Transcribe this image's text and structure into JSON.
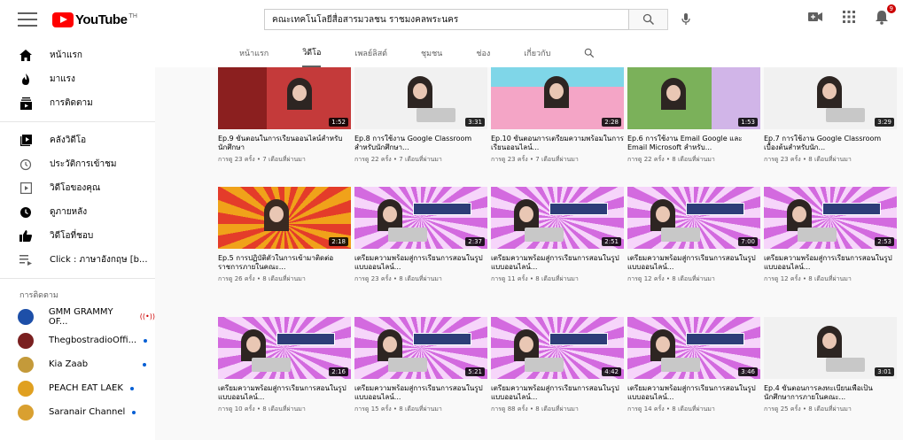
{
  "header": {
    "logo_text": "YouTube",
    "logo_region": "TH",
    "search_value": "คณะเทคโนโลยีสื่อสารมวลชน ราชมงคลพระนคร",
    "notif_count": "9"
  },
  "sidebar": {
    "main": [
      {
        "label": "หน้าแรก",
        "icon": "home-icon"
      },
      {
        "label": "มาแรง",
        "icon": "flame-icon"
      },
      {
        "label": "การติดตาม",
        "icon": "subscriptions-icon"
      }
    ],
    "library": [
      {
        "label": "คลังวิดีโอ",
        "icon": "library-icon"
      },
      {
        "label": "ประวัติการเข้าชม",
        "icon": "history-icon"
      },
      {
        "label": "วิดีโอของคุณ",
        "icon": "your-videos-icon"
      },
      {
        "label": "ดูภายหลัง",
        "icon": "watch-later-icon"
      },
      {
        "label": "วิดีโอที่ชอบ",
        "icon": "like-icon"
      },
      {
        "label": "Click : ภาษาอังกฤษ [b...",
        "icon": "playlist-icon"
      }
    ],
    "subs_heading": "การติดตาม",
    "subs": [
      {
        "label": "GMM GRAMMY OF...",
        "color": "#1d4fa8",
        "live": true
      },
      {
        "label": "ThegbostradioOffi...",
        "color": "#7a2020",
        "live": false
      },
      {
        "label": "Kia Zaab",
        "color": "#c49a3a",
        "live": false
      },
      {
        "label": "PEACH EAT LAEK",
        "color": "#e0a020",
        "live": false
      },
      {
        "label": "Saranair Channel",
        "color": "#d9a030",
        "live": false
      }
    ]
  },
  "tabs": [
    "หน้าแรก",
    "วิดีโอ",
    "เพลย์ลิสต์",
    "ชุมชน",
    "ช่อง",
    "เกี่ยวกับ"
  ],
  "active_tab": 1,
  "videos": [
    [
      {
        "title": "Ep.9 ขั้นตอนในการเรียนออนไลน์สำหรับนักศึกษา",
        "meta": "การดู 23 ครั้ง • 7 เดือนที่ผ่านมา",
        "duration": "1:52",
        "style": "red"
      },
      {
        "title": "Ep.8 การใช้งาน Google Classroom สำหรับนักศึกษา...",
        "meta": "การดู 22 ครั้ง • 7 เดือนที่ผ่านมา",
        "duration": "3:31",
        "style": "white"
      },
      {
        "title": "Ep.10 ขั้นตอนการเตรียมความพร้อมในการเรียนออนไลน์...",
        "meta": "การดู 23 ครั้ง • 7 เดือนที่ผ่านมา",
        "duration": "2:28",
        "style": "pink"
      },
      {
        "title": "Ep.6 การใช้งาน Email Google และ Email Microsoft สำหรับ...",
        "meta": "การดู 22 ครั้ง • 8 เดือนที่ผ่านมา",
        "duration": "1:53",
        "style": "green"
      },
      {
        "title": "Ep.7 การใช้งาน Google Classroom เบื้องต้นสำหรับนัก...",
        "meta": "การดู 23 ครั้ง • 8 เดือนที่ผ่านมา",
        "duration": "3:29",
        "style": "white"
      }
    ],
    [
      {
        "title": "Ep.5 การปฏิบัติตัวในการเข้ามาติดต่อราชการภายในคณะ...",
        "meta": "การดู 26 ครั้ง • 8 เดือนที่ผ่านมา",
        "duration": "2:18",
        "style": "sun"
      },
      {
        "title": "เตรียมความพร้อมสู่การเรียนการสอนในรูปแบบออนไลน์...",
        "meta": "การดู 23 ครั้ง • 8 เดือนที่ผ่านมา",
        "duration": "2:37",
        "style": "burst"
      },
      {
        "title": "เตรียมความพร้อมสู่การเรียนการสอนในรูปแบบออนไลน์...",
        "meta": "การดู 11 ครั้ง • 8 เดือนที่ผ่านมา",
        "duration": "2:51",
        "style": "burst"
      },
      {
        "title": "เตรียมความพร้อมสู่การเรียนการสอนในรูปแบบออนไลน์...",
        "meta": "การดู 12 ครั้ง • 8 เดือนที่ผ่านมา",
        "duration": "7:00",
        "style": "burst"
      },
      {
        "title": "เตรียมความพร้อมสู่การเรียนการสอนในรูปแบบออนไลน์...",
        "meta": "การดู 12 ครั้ง • 8 เดือนที่ผ่านมา",
        "duration": "2:53",
        "style": "burst"
      }
    ],
    [
      {
        "title": "เตรียมความพร้อมสู่การเรียนการสอนในรูปแบบออนไลน์...",
        "meta": "การดู 10 ครั้ง • 8 เดือนที่ผ่านมา",
        "duration": "2:16",
        "style": "burst"
      },
      {
        "title": "เตรียมความพร้อมสู่การเรียนการสอนในรูปแบบออนไลน์...",
        "meta": "การดู 15 ครั้ง • 8 เดือนที่ผ่านมา",
        "duration": "5:21",
        "style": "burst"
      },
      {
        "title": "เตรียมความพร้อมสู่การเรียนการสอนในรูปแบบออนไลน์...",
        "meta": "การดู 88 ครั้ง • 8 เดือนที่ผ่านมา",
        "duration": "4:42",
        "style": "burst"
      },
      {
        "title": "เตรียมความพร้อมสู่การเรียนการสอนในรูปแบบออนไลน์...",
        "meta": "การดู 14 ครั้ง • 8 เดือนที่ผ่านมา",
        "duration": "3:46",
        "style": "burst"
      },
      {
        "title": "Ep.4 ขั้นตอนการลงทะเบียนเพื่อเป็นนักศึกษาการภายในคณะ...",
        "meta": "การดู 25 ครั้ง • 8 เดือนที่ผ่านมา",
        "duration": "3:01",
        "style": "white"
      }
    ]
  ]
}
